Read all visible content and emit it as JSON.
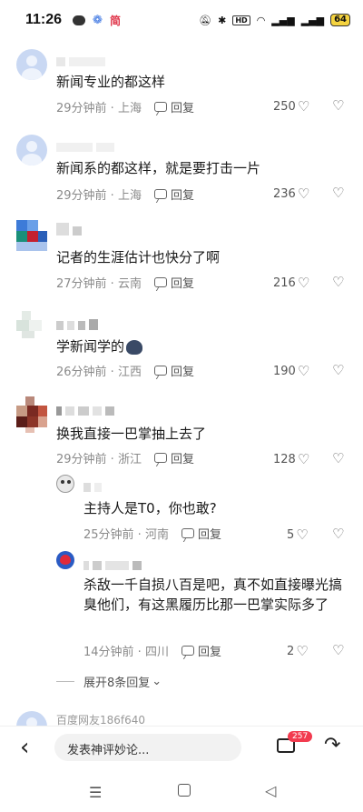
{
  "status": {
    "time": "11:26",
    "jian": "简",
    "battery": "64",
    "hd": "HD"
  },
  "comments": [
    {
      "text": "新闻专业的都这样",
      "time": "29分钟前 · 上海",
      "reply": "回复",
      "likes": "250"
    },
    {
      "text": "新闻系的都这样，就是要打击一片",
      "time": "29分钟前 · 上海",
      "reply": "回复",
      "likes": "236"
    },
    {
      "text": "记者的生涯估计也快分了啊",
      "time": "27分钟前 · 云南",
      "reply": "回复",
      "likes": "216"
    },
    {
      "text": "学新闻学的",
      "time": "26分钟前 · 江西",
      "reply": "回复",
      "likes": "190"
    },
    {
      "text": "换我直接一巴掌抽上去了",
      "time": "29分钟前 · 浙江",
      "reply": "回复",
      "likes": "128"
    }
  ],
  "replies": [
    {
      "text": "主持人是T0，你也敢?",
      "time": "25分钟前 · 河南",
      "reply": "回复",
      "likes": "5"
    },
    {
      "text": "杀敌一千自损八百是吧，真不如直接曝光搞臭他们，有这黑履历比那一巴掌实际多了",
      "time": "14分钟前 · 四川",
      "reply": "回复",
      "likes": "2"
    }
  ],
  "expand_label": "展开8条回复",
  "next_user": "百度网友186f640",
  "bottom": {
    "back": "‹",
    "placeholder": "发表神评妙论...",
    "comment_count": "257",
    "share": "↷"
  },
  "nav": {
    "menu": "☰",
    "back": "◁"
  }
}
